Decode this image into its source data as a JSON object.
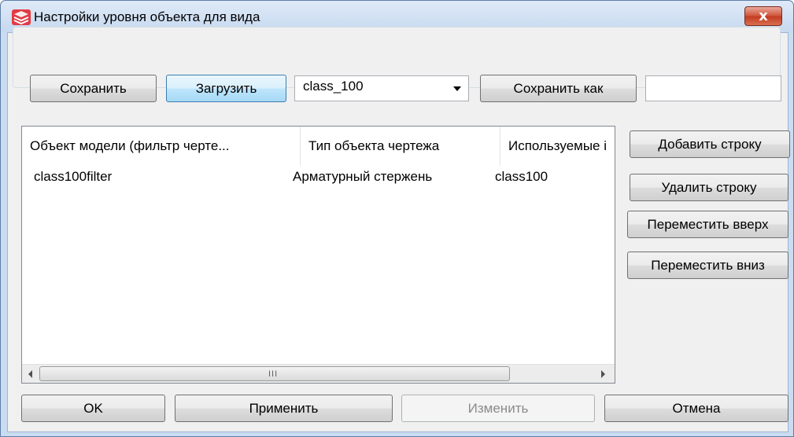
{
  "window": {
    "title": "Настройки уровня объекта для вида",
    "close_label": "x",
    "accent": "#e23b44"
  },
  "toolbar": {
    "save_label": "Сохранить",
    "load_label": "Загрузить",
    "preset_value": "class_100",
    "save_as_label": "Сохранить как",
    "name_value": ""
  },
  "table": {
    "columns": [
      "Объект модели (фильтр черте...",
      "Тип объекта чертежа",
      "Используемые і"
    ],
    "rows": [
      [
        "class100filter",
        "Арматурный стержень",
        "class100"
      ]
    ],
    "scroll_grip": "III"
  },
  "side_buttons": {
    "add_row": "Добавить строку",
    "delete_row": "Удалить строку",
    "move_up": "Переместить вверх",
    "move_down": "Переместить вниз"
  },
  "footer": {
    "ok": "OK",
    "apply": "Применить",
    "modify": "Изменить",
    "cancel": "Отмена"
  }
}
